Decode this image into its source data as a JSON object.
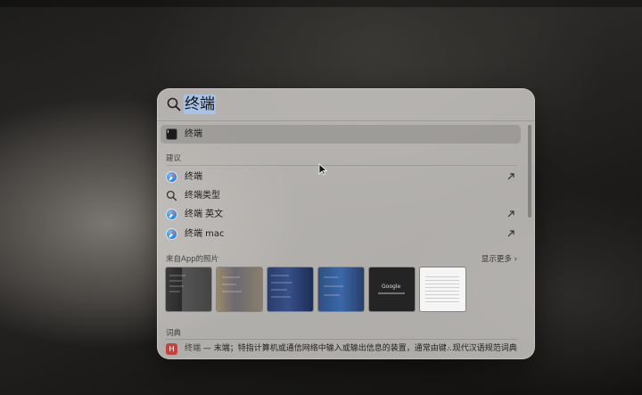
{
  "spotlight": {
    "query": "终端",
    "top_hit": {
      "label": "终端",
      "icon": "terminal-icon"
    },
    "suggestions_title": "建议",
    "suggestions": [
      {
        "label": "终端",
        "icon": "safari-icon",
        "has_arrow": true
      },
      {
        "label": "终端类型",
        "icon": "search-icon",
        "has_arrow": false
      },
      {
        "label": "终端 英文",
        "icon": "safari-icon",
        "has_arrow": true
      },
      {
        "label": "终端 mac",
        "icon": "safari-icon",
        "has_arrow": true
      }
    ],
    "photos_title": "来自App的照片",
    "show_more": "显示更多",
    "photos": [
      {
        "name": "photo-thumb-1"
      },
      {
        "name": "photo-thumb-2"
      },
      {
        "name": "photo-thumb-3"
      },
      {
        "name": "photo-thumb-4"
      },
      {
        "name": "photo-thumb-5",
        "text": "Google"
      },
      {
        "name": "photo-thumb-6"
      }
    ],
    "dictionary_title": "词典",
    "dictionary": {
      "word": "终端",
      "definition": " — 末端；特指计算机或通信网络中输入或输出信息的装置，通常由键…",
      "separator": "·",
      "source": "现代汉语规范词典",
      "icon_text": "H"
    }
  }
}
